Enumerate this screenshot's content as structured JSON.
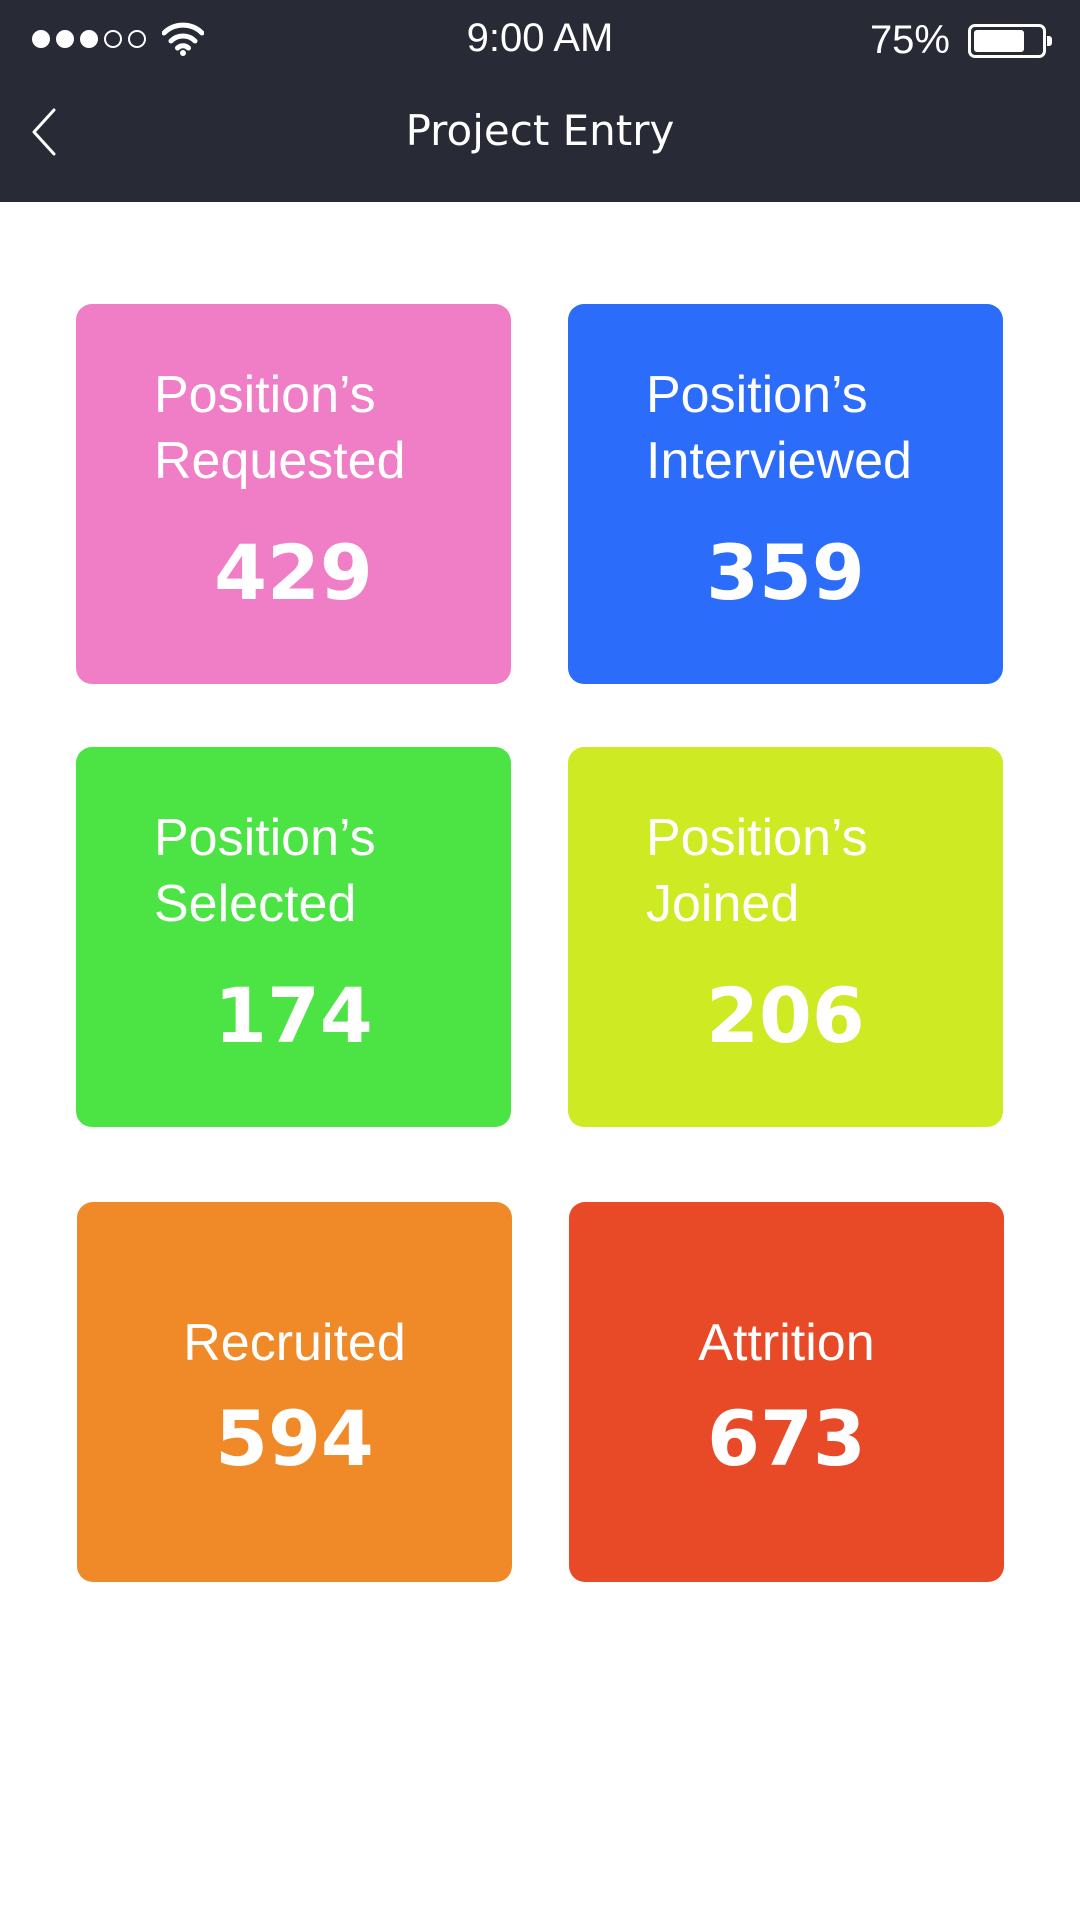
{
  "status_bar": {
    "time": "9:00 AM",
    "battery_percent": "75%",
    "battery_level": 0.75,
    "signal_bars_filled": 3,
    "signal_bars_total": 5
  },
  "header": {
    "title": "Project Entry",
    "back_icon": "chevron-left-icon",
    "background": "#282b35"
  },
  "cards": [
    {
      "line1": "Position’s",
      "line2": "Requested",
      "value": "429",
      "color": "#f07ec6"
    },
    {
      "line1": "Position’s",
      "line2": "Interviewed",
      "value": "359",
      "color": "#2c6cfa"
    },
    {
      "line1": "Position’s",
      "line2": "Selected",
      "value": "174",
      "color": "#4ce344"
    },
    {
      "line1": "Position’s",
      "line2": "Joined",
      "value": "206",
      "color": "#cdea23"
    },
    {
      "line1": "Recruited",
      "value": "594",
      "color": "#f08a28"
    },
    {
      "line1": "Attrition",
      "value": "673",
      "color": "#e84a27"
    }
  ]
}
